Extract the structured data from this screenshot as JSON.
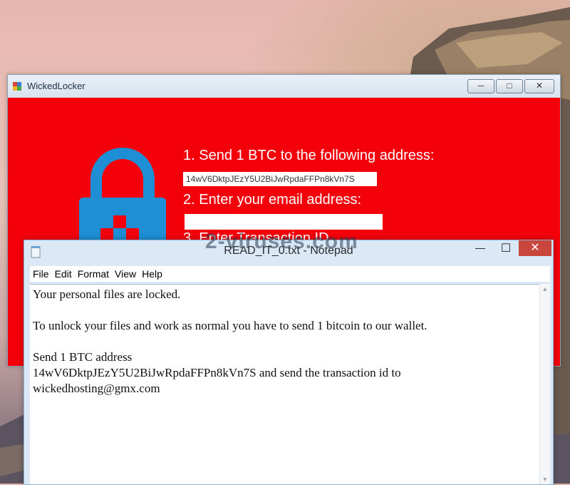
{
  "locker_window": {
    "title": "WickedLocker",
    "steps": [
      "1. Send 1 BTC to the following address:",
      "2. Enter your email address:",
      "3. Enter Transaction ID"
    ],
    "btc_address": "14wV6DktpJEzY5U2BiJwRpdaFFPn8kVn7S",
    "email_value": ""
  },
  "notepad": {
    "title": "READ_IT_0.txt - Notepad",
    "menu": [
      "File",
      "Edit",
      "Format",
      "View",
      "Help"
    ],
    "lines": [
      "Your personal files are locked.",
      "",
      "To unlock your files and work as normal you have to send 1 bitcoin to our wallet.",
      "",
      "Send 1 BTC address",
      "14wV6DktpJEzY5U2BiJwRpdaFFPn8kVn7S and send the transaction id to",
      "wickedhosting@gmx.com"
    ]
  },
  "watermark": "2-viruses.com",
  "colors": {
    "ransom_red": "#f4000b",
    "lock_blue": "#1e8fd4"
  }
}
